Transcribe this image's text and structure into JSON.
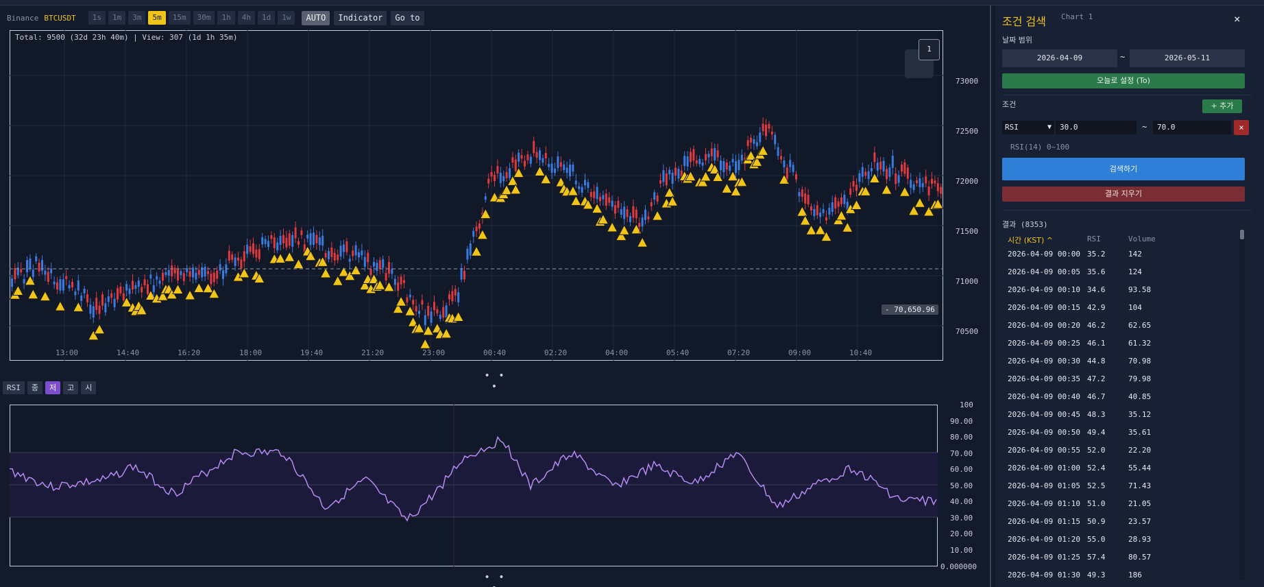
{
  "toolbar": {
    "exchange": "Binance",
    "symbol": "BTCUSDT",
    "timeframes": [
      "1s",
      "1m",
      "3m",
      "5m",
      "15m",
      "30m",
      "1h",
      "4h",
      "1d",
      "1w"
    ],
    "active_timeframe": "5m",
    "auto_label": "AUTO",
    "indicator_label": "Indicator",
    "goto_label": "Go to"
  },
  "main_chart": {
    "total_label": "Total: 9500 (32d 23h 40m) | View: 307 (1d 1h 35m)",
    "price_ticks": [
      "73000",
      "72500",
      "72000",
      "71500",
      "71000",
      "70500"
    ],
    "time_ticks": [
      "13:00",
      "14:40",
      "16:20",
      "18:00",
      "19:40",
      "21:20",
      "23:00",
      "00:40",
      "02:20",
      "04:00",
      "05:40",
      "07:20",
      "09:00",
      "10:40"
    ],
    "price_tag": "- 70,650.96",
    "page_badge": "1",
    "dots": "• • •",
    "colors": {
      "up": "#e0393e",
      "down": "#3a7be0",
      "marker": "#f0c419",
      "grid": "#1f2940"
    }
  },
  "rsi_bar": {
    "buttons": [
      "RSI",
      "종",
      "저",
      "고",
      "시"
    ],
    "active": "저"
  },
  "rsi_chart": {
    "ticks": [
      "100",
      "90.00",
      "80.00",
      "70.00",
      "60.00",
      "50.00",
      "40.00",
      "30.00",
      "20.00",
      "10.00",
      "0.000000"
    ],
    "dots": "• • •",
    "line_color": "#b48cf0"
  },
  "side_panel": {
    "title": "조건 검색",
    "subtitle": "Chart 1",
    "close": "×",
    "date_range_label": "날짜 범위",
    "date_from": "2026-04-09",
    "date_sep": "~",
    "date_to": "2026-05-11",
    "today_button": "오늘로 설정 (To)",
    "conditions_label": "조건",
    "add_button": "+ 추가",
    "condition": {
      "indicator": "RSI",
      "min": "30.0",
      "tilde": "~",
      "max": "70.0",
      "delete": "×",
      "hint": "RSI(14)  0~100"
    },
    "search_button": "검색하기",
    "clear_button": "결과 지우기",
    "results_label": "결과 (8353)",
    "columns": {
      "time": "시간 (KST) ^",
      "rsi": "RSI",
      "volume": "Volume"
    },
    "rows": [
      {
        "time": "2026-04-09 00:00",
        "rsi": "35.2",
        "volume": "142"
      },
      {
        "time": "2026-04-09 00:05",
        "rsi": "35.6",
        "volume": "124"
      },
      {
        "time": "2026-04-09 00:10",
        "rsi": "34.6",
        "volume": "93.58"
      },
      {
        "time": "2026-04-09 00:15",
        "rsi": "42.9",
        "volume": "104"
      },
      {
        "time": "2026-04-09 00:20",
        "rsi": "46.2",
        "volume": "62.65"
      },
      {
        "time": "2026-04-09 00:25",
        "rsi": "46.1",
        "volume": "61.32"
      },
      {
        "time": "2026-04-09 00:30",
        "rsi": "44.8",
        "volume": "70.98"
      },
      {
        "time": "2026-04-09 00:35",
        "rsi": "47.2",
        "volume": "79.98"
      },
      {
        "time": "2026-04-09 00:40",
        "rsi": "46.7",
        "volume": "40.85"
      },
      {
        "time": "2026-04-09 00:45",
        "rsi": "48.3",
        "volume": "35.12"
      },
      {
        "time": "2026-04-09 00:50",
        "rsi": "49.4",
        "volume": "35.61"
      },
      {
        "time": "2026-04-09 00:55",
        "rsi": "52.0",
        "volume": "22.20"
      },
      {
        "time": "2026-04-09 01:00",
        "rsi": "52.4",
        "volume": "55.44"
      },
      {
        "time": "2026-04-09 01:05",
        "rsi": "52.5",
        "volume": "71.43"
      },
      {
        "time": "2026-04-09 01:10",
        "rsi": "51.0",
        "volume": "21.05"
      },
      {
        "time": "2026-04-09 01:15",
        "rsi": "50.9",
        "volume": "23.57"
      },
      {
        "time": "2026-04-09 01:20",
        "rsi": "55.0",
        "volume": "28.93"
      },
      {
        "time": "2026-04-09 01:25",
        "rsi": "57.4",
        "volume": "80.57"
      },
      {
        "time": "2026-04-09 01:30",
        "rsi": "49.3",
        "volume": "186"
      }
    ]
  }
}
